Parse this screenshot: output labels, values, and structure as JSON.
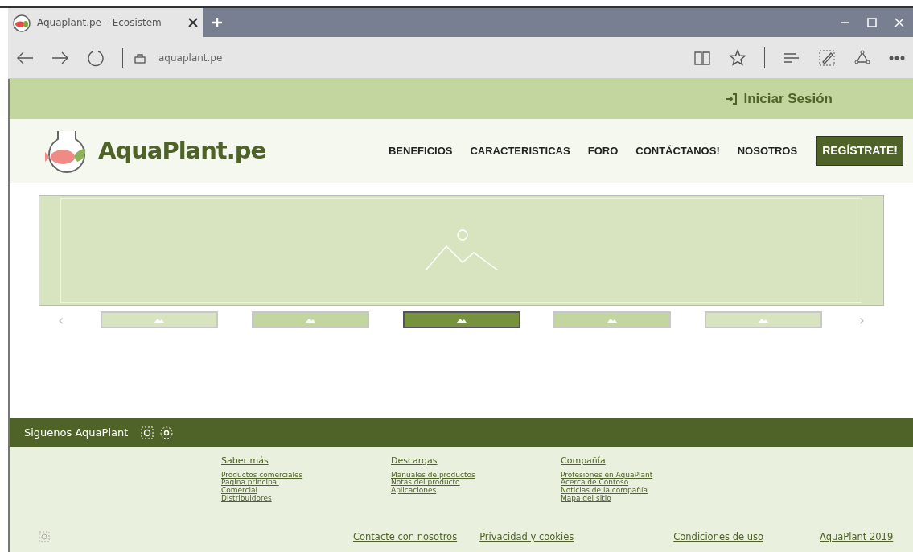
{
  "browser": {
    "tab_title": "Aquaplant.pe – Ecosistem",
    "address": "aquaplant.pe"
  },
  "topbar": {
    "login": "Iniciar Sesión"
  },
  "header": {
    "logo_text": "AquaPlant.pe",
    "nav": [
      "BENEFICIOS",
      "CARACTERISTICAS",
      "FORO",
      "CONTÁCTANOS!",
      "NOSOTROS"
    ],
    "cta": "REGÍSTRATE!"
  },
  "carousel": {
    "prev": "‹",
    "next": "›",
    "thumbnails": [
      {
        "selected": false,
        "color": "#d8e4c0"
      },
      {
        "selected": false,
        "color": "#c4d6a0"
      },
      {
        "selected": true,
        "color": "#76923c"
      },
      {
        "selected": false,
        "color": "#c4d6a0"
      },
      {
        "selected": false,
        "color": "#d8e4c0"
      }
    ]
  },
  "footer": {
    "follow": "Siguenos AquaPlant",
    "columns": [
      {
        "title": "Saber más",
        "links": [
          "Productos comerciales",
          "Pagina principal",
          "Comercial",
          "Distribuidores"
        ]
      },
      {
        "title": "Descargas",
        "links": [
          "Manuales de productos",
          "Notas del producto",
          "Aplicaciones"
        ]
      },
      {
        "title": "Compañía",
        "links": [
          "Profesiones en AquaPlant",
          "Acerca de Contoso",
          "Noticias de la compañía",
          "Mapa del sitio"
        ]
      }
    ],
    "bottom_links": [
      "Contacte con nosotros",
      "Privacidad y cookies",
      "Condiciones de uso",
      "AquaPlant 2019"
    ]
  }
}
